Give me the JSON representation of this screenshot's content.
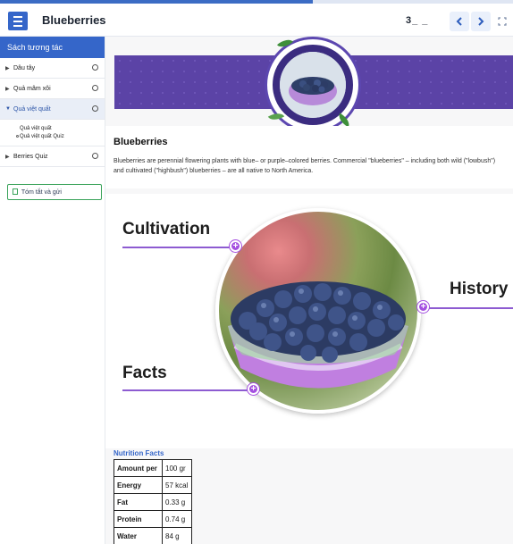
{
  "progress": {
    "fraction": 0.61
  },
  "header": {
    "title": "Blueberries",
    "page_counter": "3_ _",
    "prev_icon": "chevron-left-icon",
    "next_icon": "chevron-right-icon",
    "fullscreen_icon": "fullscreen-icon",
    "menu_icon": "hamburger-menu-icon"
  },
  "sidebar": {
    "title": "Sách tương tác",
    "items": [
      {
        "label": "Dâu tây"
      },
      {
        "label": "Quả mâm xôi"
      },
      {
        "label": "Quả việt quất"
      },
      {
        "label": "Berries Quiz"
      }
    ],
    "sub_items": [
      {
        "label": "Quả việt quất"
      },
      {
        "label": "Quả việt quất Quiz"
      }
    ],
    "summary_label": "Tóm tắt và gửi"
  },
  "intro": {
    "title": "Blueberries",
    "text": "Blueberries are perennial flowering plants with blue– or purple–colored berries. Commercial \"blueberries\" – including both wild (\"lowbush\") and cultivated (\"highbush\") blueberries – are all native to North America."
  },
  "hotspots": {
    "cultivation": "Cultivation",
    "history": "History",
    "facts": "Facts"
  },
  "nutrition": {
    "title": "Nutrition Facts",
    "rows": [
      {
        "key": "Amount per",
        "value": "100 gr"
      },
      {
        "key": "Energy",
        "value": "57 kcal"
      },
      {
        "key": "Fat",
        "value": "0.33 g"
      },
      {
        "key": "Protein",
        "value": "0.74 g"
      },
      {
        "key": "Water",
        "value": "84 g"
      }
    ]
  },
  "colors": {
    "accent": "#3566c9",
    "banner": "#5b43a6",
    "hotspot": "#a44fe0"
  }
}
